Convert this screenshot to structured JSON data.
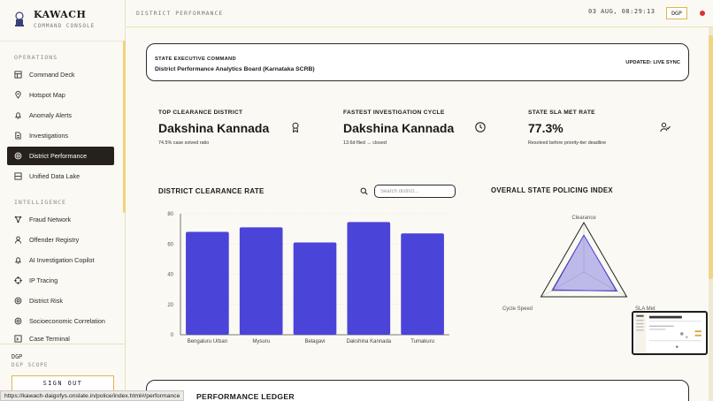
{
  "app": {
    "title": "KAWACH",
    "subtitle": "COMMAND CONSOLE"
  },
  "sidebar": {
    "sections": [
      {
        "label": "OPERATIONS"
      },
      {
        "label": "INTELLIGENCE"
      }
    ],
    "items": [
      {
        "label": "Command Deck",
        "icon": "command-deck-icon"
      },
      {
        "label": "Hotspot Map",
        "icon": "map-pin-icon"
      },
      {
        "label": "Anomaly Alerts",
        "icon": "bell-icon"
      },
      {
        "label": "Investigations",
        "icon": "document-icon"
      },
      {
        "label": "District Performance",
        "icon": "target-icon",
        "active": true
      },
      {
        "label": "Unified Data Lake",
        "icon": "database-icon"
      },
      {
        "label": "Fraud Network",
        "icon": "network-icon"
      },
      {
        "label": "Offender Registry",
        "icon": "user-icon"
      },
      {
        "label": "AI Investigation Copilot",
        "icon": "bell-icon"
      },
      {
        "label": "IP Tracing",
        "icon": "crosshair-icon"
      },
      {
        "label": "District Risk",
        "icon": "target-icon"
      },
      {
        "label": "Socioeconomic Correlation",
        "icon": "target-icon"
      },
      {
        "label": "Case Terminal",
        "icon": "terminal-icon"
      }
    ],
    "user": {
      "name": "DGP",
      "scope": "DGP SCOPE",
      "signout_label": "SIGN OUT"
    }
  },
  "topbar": {
    "title": "DISTRICT PERFORMANCE",
    "clock": "03 AUG, 08:29:13",
    "role": "DGP",
    "status_color": "#d8323a"
  },
  "header_card": {
    "label": "STATE EXECUTIVE COMMAND",
    "title": "District Performance Analytics Board (Karnataka SCRB)",
    "updated": "UPDATED: LIVE SYNC"
  },
  "stats": [
    {
      "label": "TOP CLEARANCE DISTRICT",
      "value": "Dakshina Kannada",
      "sub": "74.5% case solved ratio",
      "icon": "award-icon"
    },
    {
      "label": "FASTEST INVESTIGATION CYCLE",
      "value": "Dakshina Kannada",
      "sub": "13.6d filed → closed",
      "icon": "clock-icon"
    },
    {
      "label": "STATE SLA MET RATE",
      "value": "77.3%",
      "sub": "Resolved before priority-tier deadline",
      "icon": "user-check-icon"
    }
  ],
  "clearance": {
    "title": "DISTRICT CLEARANCE RATE",
    "search_placeholder": "Search district..."
  },
  "index": {
    "title": "OVERALL STATE POLICING INDEX",
    "axes": [
      "Clearance",
      "SLA Met",
      "Cycle Speed"
    ],
    "values": [
      74.5,
      77.3,
      72
    ],
    "accent": "#4b44d8"
  },
  "chart_data": {
    "type": "bar",
    "categories": [
      "Bengaluru Urban",
      "Mysuru",
      "Belagavi",
      "Dakshina Kannada",
      "Tumakuru"
    ],
    "values": [
      68,
      71,
      61,
      74.5,
      67
    ],
    "ylim": [
      0,
      80
    ],
    "yticks": [
      "0",
      "20",
      "40",
      "60",
      "80"
    ],
    "grid": true,
    "color": "#4b44d8"
  },
  "ledger": {
    "title": "PERFORMANCE LEDGER"
  },
  "status_url": "https://kawach-daigofys.onslate.in/police/index.html#/performance"
}
